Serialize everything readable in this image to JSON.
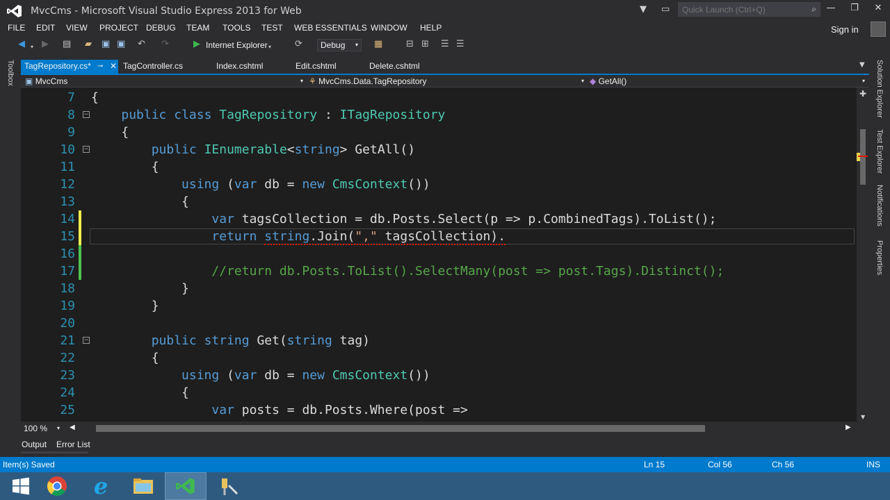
{
  "window": {
    "title": "MvcCms - Microsoft Visual Studio Express 2013 for Web",
    "quick_launch_placeholder": "Quick Launch (Ctrl+Q)"
  },
  "menu": [
    "FILE",
    "EDIT",
    "VIEW",
    "PROJECT",
    "DEBUG",
    "TEAM",
    "TOOLS",
    "TEST",
    "WEB ESSENTIALS",
    "WINDOW",
    "HELP"
  ],
  "signin_label": "Sign in",
  "toolbar": {
    "browser_label": "Internet Explorer",
    "config_label": "Debug"
  },
  "left_panel": {
    "toolbox_label": "Toolbox"
  },
  "right_panel": [
    "Solution Explorer",
    "Test Explorer",
    "Notifications",
    "Properties"
  ],
  "tabs": [
    {
      "label": "TagRepository.cs*",
      "active": true
    },
    {
      "label": "TagController.cs"
    },
    {
      "label": "Index.cshtml"
    },
    {
      "label": "Edit.cshtml"
    },
    {
      "label": "Delete.cshtml"
    }
  ],
  "navbar": {
    "project": "MvcCms",
    "type": "MvcCms.Data.TagRepository",
    "member": "GetAll()"
  },
  "code_lines": [
    {
      "n": "7",
      "text": "{"
    },
    {
      "n": "8",
      "text": "    public class TagRepository : ITagRepository"
    },
    {
      "n": "9",
      "text": "    {"
    },
    {
      "n": "10",
      "text": "        public IEnumerable<string> GetAll()"
    },
    {
      "n": "11",
      "text": "        {"
    },
    {
      "n": "12",
      "text": "            using (var db = new CmsContext())"
    },
    {
      "n": "13",
      "text": "            {"
    },
    {
      "n": "14",
      "text": "                var tagsCollection = db.Posts.Select(p => p.CombinedTags).ToList();"
    },
    {
      "n": "15",
      "text": "                return string.Join(\",\" tagsCollection)."
    },
    {
      "n": "16",
      "text": ""
    },
    {
      "n": "17",
      "text": "                //return db.Posts.ToList().SelectMany(post => post.Tags).Distinct();"
    },
    {
      "n": "18",
      "text": "            }"
    },
    {
      "n": "19",
      "text": "        }"
    },
    {
      "n": "20",
      "text": ""
    },
    {
      "n": "21",
      "text": "        public string Get(string tag)"
    },
    {
      "n": "22",
      "text": "        {"
    },
    {
      "n": "23",
      "text": "            using (var db = new CmsContext())"
    },
    {
      "n": "24",
      "text": "            {"
    },
    {
      "n": "25",
      "text": "                var posts = db.Posts.Where(post =>"
    }
  ],
  "zoom": "100 %",
  "bottom_tabs": [
    "Output",
    "Error List"
  ],
  "status": {
    "message": "Item(s) Saved",
    "ln": "Ln 15",
    "col": "Col 56",
    "ch": "Ch 56",
    "mode": "INS"
  },
  "colors": {
    "accent": "#007acc",
    "keyword": "#569cd6",
    "type": "#4ec9b0",
    "string": "#d69d85",
    "comment": "#57a64a",
    "line_number": "#2b91af"
  }
}
